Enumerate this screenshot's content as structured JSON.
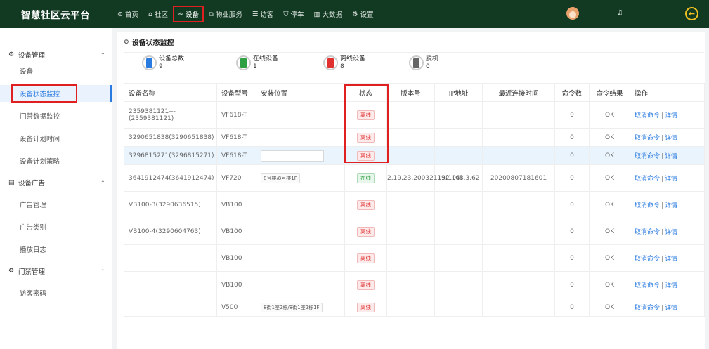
{
  "brand": "智慧社区云平台",
  "nav": [
    {
      "icon": "⊙",
      "label": "首页"
    },
    {
      "icon": "⌂",
      "label": "社区"
    },
    {
      "icon": "⩪",
      "label": "设备",
      "active": true
    },
    {
      "icon": "⧉",
      "label": "物业服务"
    },
    {
      "icon": "☰",
      "label": "访客"
    },
    {
      "icon": "⛉",
      "label": "停车"
    },
    {
      "icon": "▥",
      "label": "大数据"
    },
    {
      "icon": "⚙",
      "label": "设置"
    }
  ],
  "sidebar": {
    "groups": [
      {
        "label": "设备管理",
        "icon": "gear-icon",
        "items": [
          "设备",
          "设备状态监控",
          "门禁数据监控",
          "设备计划时间",
          "设备计划策略"
        ]
      },
      {
        "label": "设备广告",
        "icon": "list-icon",
        "items": [
          "广告管理",
          "广告类别",
          "播放日志"
        ]
      },
      {
        "label": "门禁管理",
        "icon": "gear-icon",
        "items": [
          "访客密码"
        ]
      }
    ],
    "active_item": "设备状态监控"
  },
  "page_title": "设备状态监控",
  "stats": [
    {
      "label": "设备总数",
      "value": "9",
      "color": "#2a7be0"
    },
    {
      "label": "在线设备",
      "value": "1",
      "color": "#2ea043"
    },
    {
      "label": "离线设备",
      "value": "8",
      "color": "#e03030"
    },
    {
      "label": "脱机",
      "value": "0",
      "color": "#666666"
    }
  ],
  "table": {
    "headers": [
      "设备名称",
      "设备型号",
      "安装位置",
      "状态",
      "版本号",
      "IP地址",
      "最近连接时间",
      "命令数",
      "命令结果",
      "操作"
    ],
    "rows": [
      {
        "name": "2359381121---(2359381121)",
        "model": "VF618-T",
        "location": "",
        "status": "离线",
        "version": "",
        "ip": "",
        "last": "",
        "cmd": "0",
        "result": "OK"
      },
      {
        "name": "3290651838(3290651838)",
        "model": "VF618-T",
        "location": "",
        "status": "离线",
        "version": "",
        "ip": "",
        "last": "",
        "cmd": "0",
        "result": "OK"
      },
      {
        "name": "3296815271(3296815271)",
        "model": "VF618-T",
        "location": "",
        "status": "离线",
        "version": "",
        "ip": "",
        "last": "",
        "cmd": "0",
        "result": "OK"
      },
      {
        "name": "3641912474(3641912474)",
        "model": "VF720",
        "location": "8号楼/8号楼1F",
        "status": "在线",
        "version": "2.19.23.20032113(104)",
        "ip": "192.168.3.62",
        "last": "20200807181601",
        "cmd": "0",
        "result": "OK"
      },
      {
        "name": "VB100-3(3290636515)",
        "model": "VB100",
        "location": "",
        "status": "离线",
        "version": "",
        "ip": "",
        "last": "",
        "cmd": "0",
        "result": "OK"
      },
      {
        "name": "VB100-4(3290604763)",
        "model": "VB100",
        "location": "",
        "status": "离线",
        "version": "",
        "ip": "",
        "last": "",
        "cmd": "0",
        "result": "OK"
      },
      {
        "name": "",
        "model": "VB100",
        "location": "",
        "status": "离线",
        "version": "",
        "ip": "",
        "last": "",
        "cmd": "0",
        "result": "OK"
      },
      {
        "name": "",
        "model": "VB100",
        "location": "",
        "status": "离线",
        "version": "",
        "ip": "",
        "last": "",
        "cmd": "0",
        "result": "OK"
      },
      {
        "name": "",
        "model": "V500",
        "location": "8街1座2栋/8街1座2栋1F",
        "status": "离线",
        "version": "",
        "ip": "",
        "last": "",
        "cmd": "0",
        "result": "OK"
      }
    ],
    "op_cancel": "取消命令",
    "op_sep": "|",
    "op_detail": "详情"
  }
}
